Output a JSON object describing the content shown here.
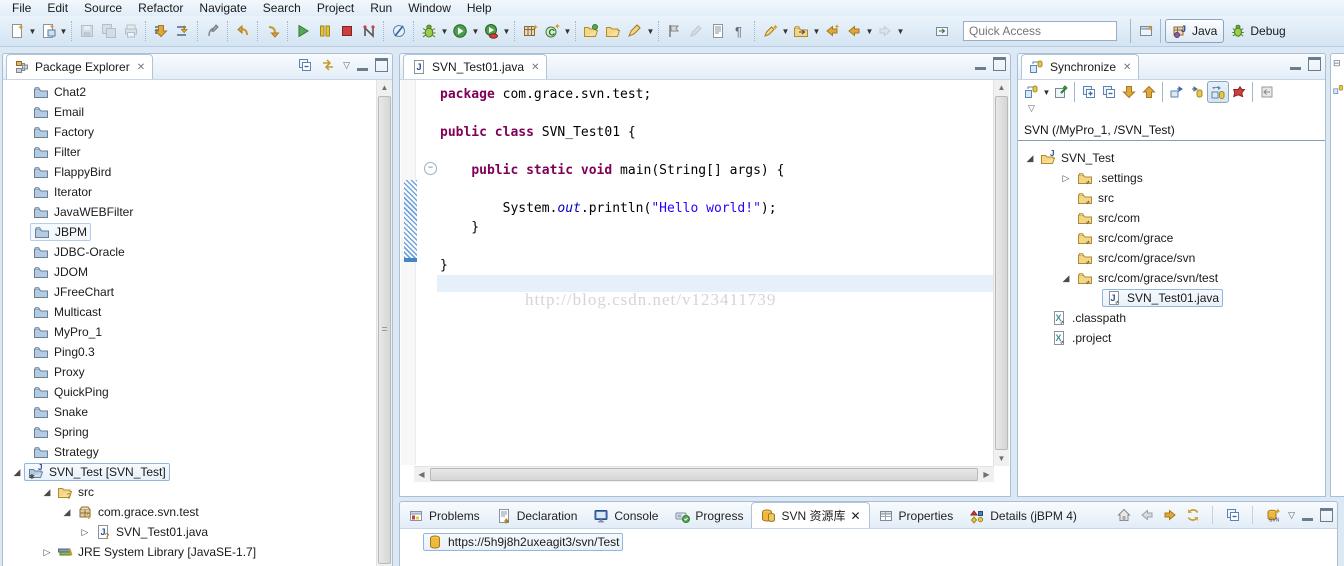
{
  "menu": {
    "items": [
      "File",
      "Edit",
      "Source",
      "Refactor",
      "Navigate",
      "Search",
      "Project",
      "Run",
      "Window",
      "Help"
    ]
  },
  "toolbar": {
    "icons": [
      {
        "name": "new-icon",
        "dd": true
      },
      {
        "name": "new-wizard-icon",
        "dd": true,
        "sepAfter": true
      },
      {
        "name": "save-icon",
        "disabled": true
      },
      {
        "name": "save-all-icon",
        "disabled": true
      },
      {
        "name": "print-icon",
        "disabled": true,
        "sepAfter": true
      },
      {
        "name": "build-all-icon"
      },
      {
        "name": "toggle-build-icon",
        "sepAfter": true
      },
      {
        "name": "last-edit-location-icon",
        "sepAfter": true
      },
      {
        "name": "back-curve-icon",
        "sepAfter": true
      },
      {
        "name": "forward-curve-icon",
        "sepAfter": true
      },
      {
        "name": "resume-icon"
      },
      {
        "name": "suspend-icon"
      },
      {
        "name": "terminate-icon"
      },
      {
        "name": "profile-icon",
        "sepAfter": true
      },
      {
        "name": "skip-breakpoints-icon",
        "sepAfter": true
      },
      {
        "name": "debug-launch-icon",
        "dd": true
      },
      {
        "name": "run-launch-icon",
        "dd": true
      },
      {
        "name": "run-last-icon",
        "dd": true,
        "sepAfter": true
      },
      {
        "name": "new-java-project-icon"
      },
      {
        "name": "new-class-icon",
        "dd": true,
        "sepAfter": true
      },
      {
        "name": "open-type-icon"
      },
      {
        "name": "open-resource-icon"
      },
      {
        "name": "annotate-icon",
        "dd": true,
        "sepAfter": true
      },
      {
        "name": "task-flag-icon"
      },
      {
        "name": "edit-disabled-icon",
        "disabled": true
      },
      {
        "name": "show-doc-icon"
      },
      {
        "name": "show-whitespace-icon",
        "sepAfter": true
      },
      {
        "name": "mark-occurrences-icon",
        "dd": true
      },
      {
        "name": "link-with-editor-icon",
        "dd": true
      },
      {
        "name": "back-star-icon"
      },
      {
        "name": "back-nav-icon",
        "dd": true
      },
      {
        "name": "forward-nav-icon",
        "dd": true,
        "disabled": true
      }
    ],
    "fast_view_icon": "fast-view-icon",
    "quick_access": {
      "placeholder": "Quick Access"
    },
    "perspective_bar": {
      "open_perspective_icon": "open-perspective-icon",
      "java_label": "Java",
      "debug_label": "Debug"
    }
  },
  "package_explorer": {
    "title": "Package Explorer",
    "tools": [
      "collapse-all-icon",
      "link-with-editor-icon",
      "view-menu-icon",
      "minimize-icon",
      "maximize-icon"
    ],
    "items": [
      {
        "label": "Chat2",
        "kind": "project"
      },
      {
        "label": "Email",
        "kind": "project"
      },
      {
        "label": "Factory",
        "kind": "project"
      },
      {
        "label": "Filter",
        "kind": "project"
      },
      {
        "label": "FlappyBird",
        "kind": "project"
      },
      {
        "label": "Iterator",
        "kind": "project"
      },
      {
        "label": "JavaWEBFilter",
        "kind": "project"
      },
      {
        "label": "JBPM",
        "kind": "project",
        "hover": true
      },
      {
        "label": "JDBC-Oracle",
        "kind": "project"
      },
      {
        "label": "JDOM",
        "kind": "project"
      },
      {
        "label": "JFreeChart",
        "kind": "project"
      },
      {
        "label": "Multicast",
        "kind": "project"
      },
      {
        "label": "MyPro_1",
        "kind": "project"
      },
      {
        "label": "Ping0.3",
        "kind": "project"
      },
      {
        "label": "Proxy",
        "kind": "project"
      },
      {
        "label": "QuickPing",
        "kind": "project"
      },
      {
        "label": "Snake",
        "kind": "project"
      },
      {
        "label": "Spring",
        "kind": "project"
      },
      {
        "label": "Strategy",
        "kind": "project"
      },
      {
        "label": "SVN_Test [SVN_Test]",
        "kind": "project-open",
        "depth": 0,
        "arrow": "open",
        "selected": true
      },
      {
        "label": "src",
        "kind": "srcfolder",
        "depth": 1,
        "arrow": "open"
      },
      {
        "label": "com.grace.svn.test",
        "kind": "package",
        "depth": 2,
        "arrow": "open"
      },
      {
        "label": "SVN_Test01.java",
        "kind": "javafile",
        "depth": 3,
        "arrow": "closed"
      },
      {
        "label": "JRE System Library [JavaSE-1.7]",
        "kind": "library",
        "depth": 1,
        "arrow": "closed"
      }
    ]
  },
  "editor": {
    "tab": "SVN_Test01.java",
    "watermark": "http://blog.csdn.net/v123411739",
    "code": [
      {
        "tokens": [
          {
            "c": "kw",
            "t": "package"
          },
          {
            "c": "pl",
            "t": " com.grace.svn.test;"
          }
        ]
      },
      {
        "tokens": []
      },
      {
        "tokens": [
          {
            "c": "kw",
            "t": "public"
          },
          {
            "c": "pl",
            "t": " "
          },
          {
            "c": "kw",
            "t": "class"
          },
          {
            "c": "pl",
            "t": " SVN_Test01 {"
          }
        ]
      },
      {
        "tokens": []
      },
      {
        "tokens": [
          {
            "c": "pl",
            "t": "    "
          },
          {
            "c": "kw",
            "t": "public"
          },
          {
            "c": "pl",
            "t": " "
          },
          {
            "c": "kw",
            "t": "static"
          },
          {
            "c": "pl",
            "t": " "
          },
          {
            "c": "kw",
            "t": "void"
          },
          {
            "c": "pl",
            "t": " main(String[] args) {"
          }
        ]
      },
      {
        "tokens": []
      },
      {
        "tokens": [
          {
            "c": "pl",
            "t": "        System."
          },
          {
            "c": "fld",
            "t": "out"
          },
          {
            "c": "pl",
            "t": ".println("
          },
          {
            "c": "str",
            "t": "\"Hello world!\""
          },
          {
            "c": "pl",
            "t": ");"
          }
        ]
      },
      {
        "tokens": [
          {
            "c": "pl",
            "t": "    }"
          }
        ]
      },
      {
        "tokens": []
      },
      {
        "tokens": [
          {
            "c": "pl",
            "t": "}"
          }
        ]
      },
      {
        "tokens": []
      }
    ]
  },
  "synchronize": {
    "title": "Synchronize",
    "tools": [
      "synchronize-icon",
      "pin-icon",
      "expand-all-icon",
      "collapse-all-icon",
      "next-change-icon",
      "previous-change-icon",
      "incoming-mode-icon",
      "outgoing-mode-icon",
      "both-mode-icon",
      "conflicts-mode-icon",
      "update-icon"
    ],
    "header": "SVN (/MyPro_1, /SVN_Test)",
    "items": [
      {
        "label": "SVN_Test",
        "kind": "root",
        "arrow": "open"
      },
      {
        "label": ".settings",
        "kind": "folder",
        "arrow": "closed"
      },
      {
        "label": "src",
        "kind": "folder"
      },
      {
        "label": "src/com",
        "kind": "folder"
      },
      {
        "label": "src/com/grace",
        "kind": "folder"
      },
      {
        "label": "src/com/grace/svn",
        "kind": "folder"
      },
      {
        "label": "src/com/grace/svn/test",
        "kind": "folder",
        "arrow": "open"
      },
      {
        "label": "SVN_Test01.java",
        "kind": "file-java",
        "selected": true
      },
      {
        "label": ".classpath",
        "kind": "file-xml"
      },
      {
        "label": ".project",
        "kind": "file-xml"
      }
    ]
  },
  "bottom": {
    "tabs": [
      {
        "label": "Problems",
        "icon": "problems-icon"
      },
      {
        "label": "Declaration",
        "icon": "declaration-icon"
      },
      {
        "label": "Console",
        "icon": "console-icon"
      },
      {
        "label": "Progress",
        "icon": "progress-icon"
      },
      {
        "label": "SVN 资源库",
        "icon": "svn-repository-icon",
        "active": true,
        "close": true
      },
      {
        "label": "Properties",
        "icon": "properties-icon"
      },
      {
        "label": "Details (jBPM 4)",
        "icon": "details-icon"
      }
    ],
    "tools": [
      "home-icon",
      "back-icon",
      "forward-icon",
      "refresh-icon",
      "collapse-all-icon",
      "new-repository-icon",
      "view-menu-icon",
      "minimize-icon",
      "maximize-icon"
    ],
    "repo_url": "https://5h9j8h2uxeagit3/svn/Test"
  }
}
